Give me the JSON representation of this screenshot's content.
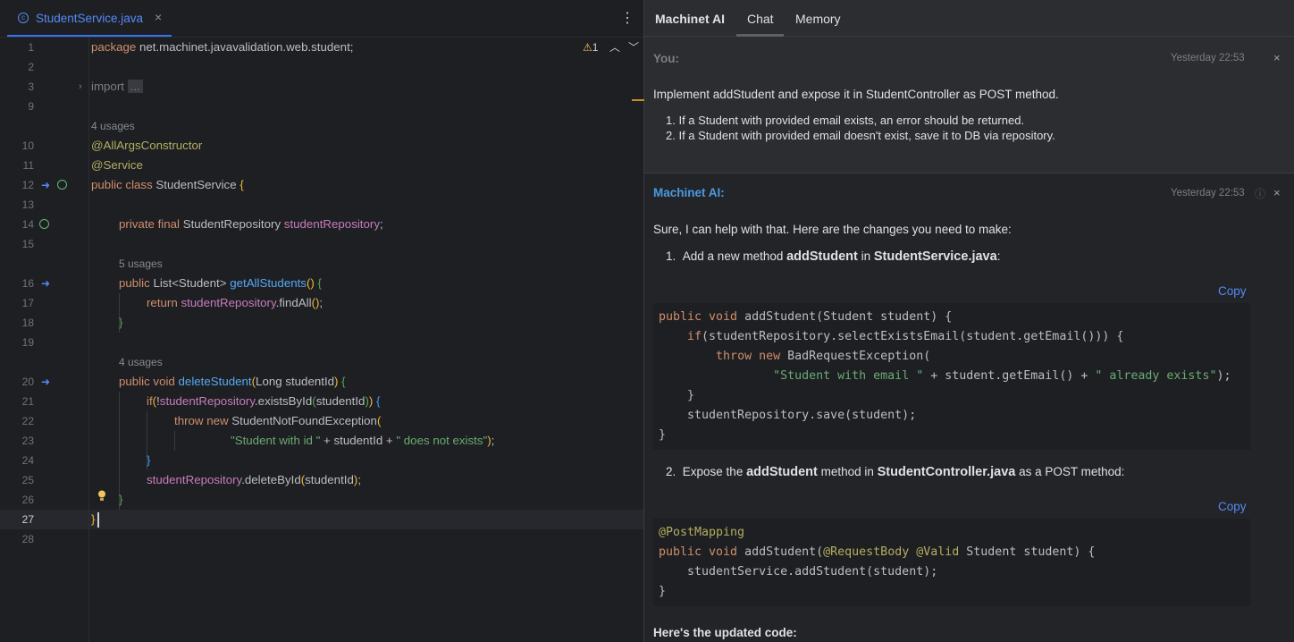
{
  "editor": {
    "tab_title": "StudentService.java",
    "tab_icon": "class-icon",
    "tab_close": "×",
    "tab_menu": "⋮",
    "warning_count": "1",
    "lines": [
      {
        "n": "1"
      },
      {
        "n": "2"
      },
      {
        "n": "3"
      },
      {
        "n": "9"
      },
      {
        "n": "10"
      },
      {
        "n": "11"
      },
      {
        "n": "12"
      },
      {
        "n": "13"
      },
      {
        "n": "14"
      },
      {
        "n": "15"
      },
      {
        "n": "16"
      },
      {
        "n": "17"
      },
      {
        "n": "18"
      },
      {
        "n": "19"
      },
      {
        "n": "20"
      },
      {
        "n": "21"
      },
      {
        "n": "22"
      },
      {
        "n": "23"
      },
      {
        "n": "24"
      },
      {
        "n": "25"
      },
      {
        "n": "26"
      },
      {
        "n": "27"
      },
      {
        "n": "28"
      }
    ],
    "usages_4": "4 usages",
    "usages_5": "5 usages",
    "usages_4b": "4 usages",
    "code": {
      "l1_kw": "package",
      "l1_rest": " net.machinet.javavalidation.web.student;",
      "l3_kw": "import",
      "l3_fold": "...",
      "l10": "@AllArgsConstructor",
      "l11": "@Service",
      "l12_kw": "public class",
      "l12_name": " StudentService ",
      "l12_br": "{",
      "l14_kw": "private final",
      "l14_type": " StudentRepository ",
      "l14_fld": "studentRepository",
      "l14_end": ";",
      "l16_kw": "public",
      "l16_type": " List<Student> ",
      "l16_fn": "getAllStudents",
      "l16_par": "()",
      "l16_br": " {",
      "l17_kw": "return",
      "l17_fld": " studentRepository",
      "l17_rest": ".findAll",
      "l17_par": "()",
      "l17_end": ";",
      "l18": "}",
      "l20_kw": "public void",
      "l20_fn": " deleteStudent",
      "l20_p1": "(",
      "l20_args": "Long studentId",
      "l20_p2": ")",
      "l20_br": " {",
      "l21_kw": "if",
      "l21_p1": "(",
      "l21_bang": "!",
      "l21_fld": "studentRepository",
      "l21_rest": ".existsById",
      "l21_p2": "(",
      "l21_arg": "studentId",
      "l21_p3": ")",
      "l21_p4": ")",
      "l21_br": " {",
      "l22_kw": "throw new",
      "l22_rest": " StudentNotFoundException",
      "l22_p": "(",
      "l23_s1": "\"Student with id \"",
      "l23_mid": " + studentId + ",
      "l23_s2": "\" does not exists\"",
      "l23_p": ")",
      "l23_end": ";",
      "l24": "}",
      "l25_fld": "studentRepository",
      "l25_rest": ".deleteById",
      "l25_p1": "(",
      "l25_arg": "studentId",
      "l25_p2": ")",
      "l25_end": ";",
      "l26": "}",
      "l27": "}"
    }
  },
  "panel": {
    "title": "Machinet AI",
    "tabs": [
      "Chat",
      "Memory"
    ],
    "user": {
      "label": "You:",
      "time": "Yesterday 22:53",
      "close": "×",
      "message": "Implement addStudent and expose it in StudentController as POST method.",
      "list": [
        "1.  If a Student with provided email exists, an error should be returned.",
        "2.  If a Student with provided email doesn't exist, save it to DB via repository."
      ]
    },
    "ai": {
      "label": "Machinet AI:",
      "time": "Yesterday 22:53",
      "info": "ⓘ",
      "close": "×",
      "intro": "Sure, I can help with that. Here are the changes you need to make:",
      "step1_num": "1.",
      "step1_a": "Add a new method ",
      "step1_b": "addStudent",
      "step1_c": " in ",
      "step1_d": "StudentService.java",
      "step1_e": ":",
      "copy1": "Copy",
      "code1": [
        "public void addStudent(Student student) {",
        "    if(studentRepository.selectExistsEmail(student.getEmail())) {",
        "        throw new BadRequestException(",
        "                \"Student with email \" + student.getEmail() + \" already exists\");",
        "    }",
        "    studentRepository.save(student);",
        "}"
      ],
      "step2_num": "2.",
      "step2_a": "Expose the ",
      "step2_b": "addStudent",
      "step2_c": " method in ",
      "step2_d": "StudentController.java",
      "step2_e": " as a POST method:",
      "copy2": "Copy",
      "code2": [
        "@PostMapping",
        "public void addStudent(@RequestBody @Valid Student student) {",
        "    studentService.addStudent(student);",
        "}"
      ],
      "outro": "Here's the updated code:"
    }
  }
}
